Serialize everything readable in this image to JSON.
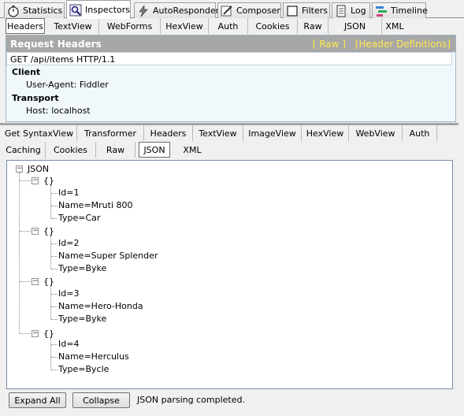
{
  "top_tabs": [
    {
      "label": "Statistics",
      "icon": "stopwatch-icon"
    },
    {
      "label": "Inspectors",
      "icon": "inspector-icon"
    },
    {
      "label": "AutoResponder",
      "icon": "lightning-icon"
    },
    {
      "label": "Composer",
      "icon": "pencil-icon"
    },
    {
      "label": "Filters",
      "icon": "checkbox-icon"
    },
    {
      "label": "Log",
      "icon": "log-icon"
    },
    {
      "label": "Timeline",
      "icon": "timeline-icon"
    }
  ],
  "request_tabs": [
    "Headers",
    "TextView",
    "WebForms",
    "HexView",
    "Auth",
    "Cookies",
    "Raw",
    "JSON",
    "XML"
  ],
  "request": {
    "title": "Request Headers",
    "raw_link": "[ Raw ]",
    "defs_link": "[Header Definitions]",
    "request_line": "GET /api/items HTTP/1.1",
    "groups": [
      {
        "name": "Client",
        "items": [
          "User-Agent: Fiddler"
        ]
      },
      {
        "name": "Transport",
        "items": [
          "Host: localhost"
        ]
      }
    ]
  },
  "response_tabs_row1": [
    "Get SyntaxView",
    "Transformer",
    "Headers",
    "TextView",
    "ImageView",
    "HexView",
    "WebView",
    "Auth"
  ],
  "response_tabs_row2": [
    "Caching",
    "Cookies",
    "Raw",
    "JSON",
    "XML"
  ],
  "tree": {
    "root": "JSON",
    "object_label": "{}",
    "objects": [
      {
        "fields": [
          "Id=1",
          "Name=Mruti 800",
          "Type=Car"
        ]
      },
      {
        "fields": [
          "Id=2",
          "Name=Super Splender",
          "Type=Byke"
        ]
      },
      {
        "fields": [
          "Id=3",
          "Name=Hero-Honda",
          "Type=Byke"
        ]
      },
      {
        "fields": [
          "Id=4",
          "Name=Herculus",
          "Type=Bycle"
        ]
      }
    ]
  },
  "bottom": {
    "expand_label": "Expand All",
    "collapse_label": "Collapse",
    "status": "JSON parsing completed."
  }
}
